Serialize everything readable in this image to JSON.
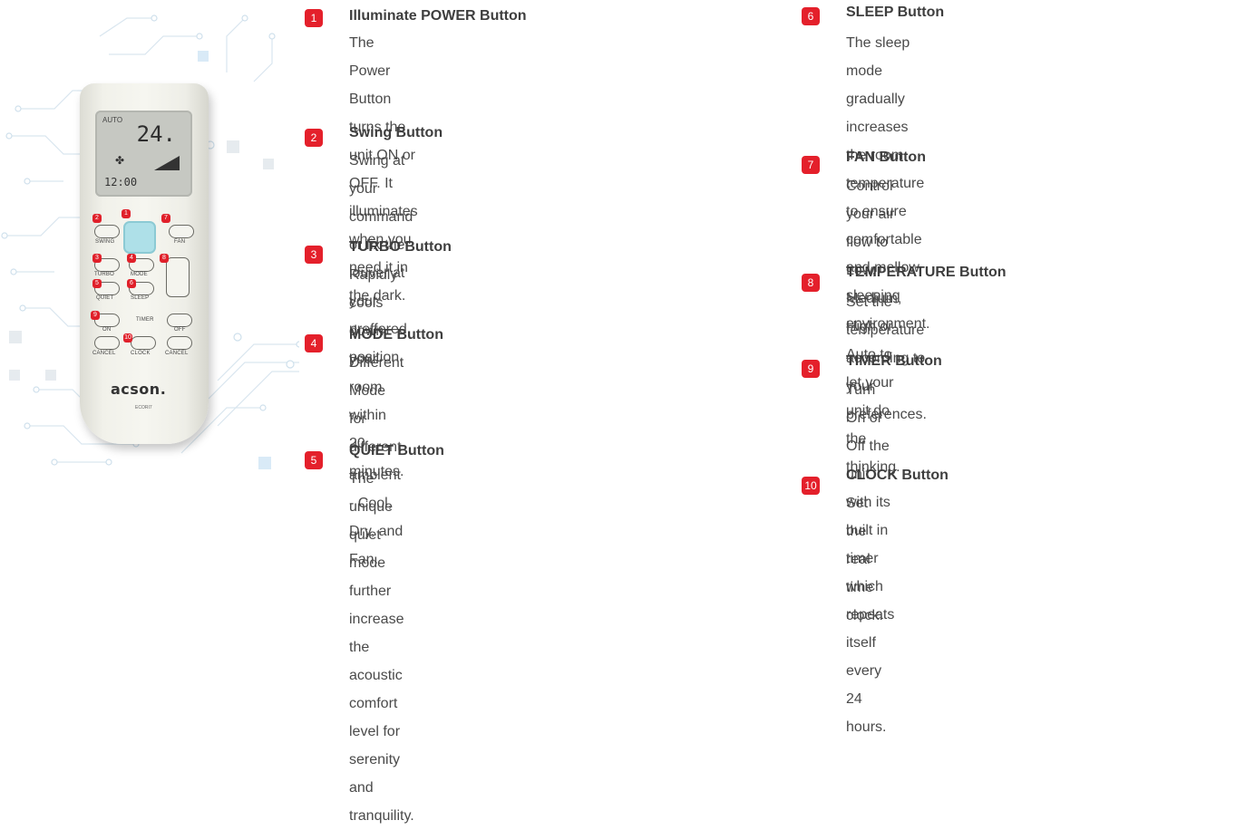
{
  "remote": {
    "lcd_temp": "24.",
    "lcd_small": "AUTO",
    "lcd_clock": "12:00",
    "button_labels": {
      "swing": "SWING",
      "fan": "FAN",
      "turbo": "TURBO",
      "mode": "MODE",
      "quiet": "QUIET",
      "sleep": "SLEEP",
      "timer": "TIMER",
      "on": "ON",
      "off": "OFF",
      "cancel_left": "CANCEL",
      "clock": "CLOCK",
      "cancel_right": "CANCEL"
    },
    "logo": "acson.",
    "model": "ECORI7"
  },
  "features_left": [
    {
      "num": "1",
      "title": "Illuminate POWER Button",
      "lines": [
        "The Power Button turns the unit ON or OFF. It",
        "illuminates when you need it in the dark."
      ]
    },
    {
      "num": "2",
      "title": "Swing Button",
      "lines": [
        "Swing at your command or fix the louver at your",
        "preffered position."
      ]
    },
    {
      "num": "3",
      "title": "TURBO Button",
      "lines": [
        "Rapidly cools down your room within 20 minutes."
      ]
    },
    {
      "num": "4",
      "title": "MODE Button",
      "lines": [
        "Different Mode for different ambient - Cool, Dry, and",
        "Fan."
      ]
    },
    {
      "num": "5",
      "title": "QUIET Button",
      "lines": [
        "The unique quiet mode further increase the acoustic",
        "comfort level for serenity and tranquility."
      ]
    }
  ],
  "features_right": [
    {
      "num": "6",
      "title": "SLEEP Button",
      "lines": [
        "The sleep mode gradually increases the room",
        "temperature to ensure comfortable and mellow",
        "sleeping environment."
      ]
    },
    {
      "num": "7",
      "title": "FAN Button",
      "lines": [
        "Control your air flow to Low, Medium, High or",
        "Auto to let your unit do the thinking."
      ]
    },
    {
      "num": "8",
      "title": "TEMPERATURE Button",
      "lines": [
        "Set the temperature according to your preferences."
      ]
    },
    {
      "num": "9",
      "title": "TIMER Button",
      "lines": [
        "Turn On or Off the unit with its built in timer",
        "which repeats itself every 24 hours."
      ]
    },
    {
      "num": "10",
      "title": "CLOCK Button",
      "lines": [
        "Set the real time clock."
      ]
    }
  ],
  "colors": {
    "badge": "#e4202b",
    "title_text": "#3e3e3e",
    "body_text": "#4a4a4a",
    "circuit": "#d4e6f2"
  }
}
